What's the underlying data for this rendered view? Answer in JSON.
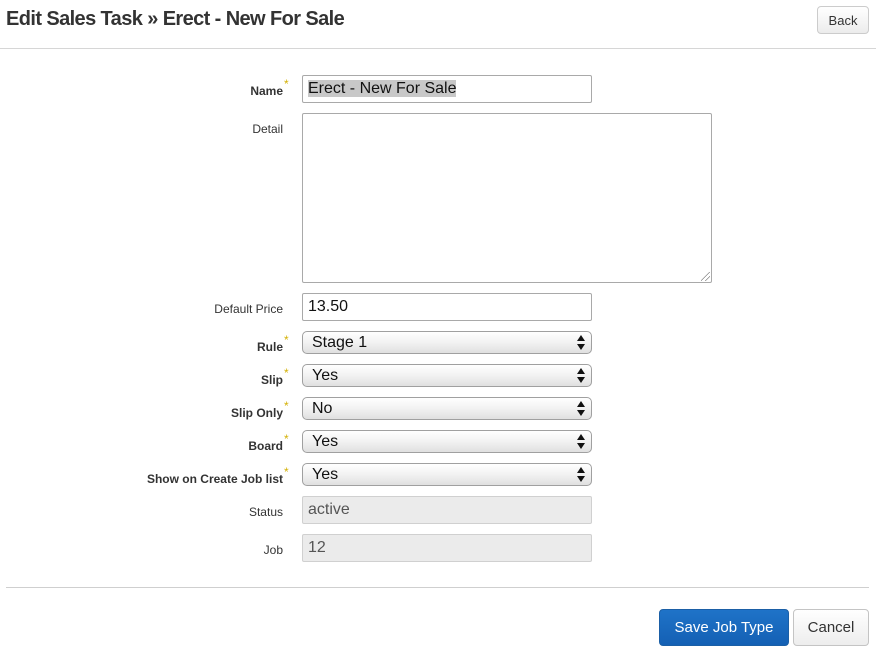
{
  "header": {
    "title": "Edit Sales Task » Erect - New For Sale",
    "back_label": "Back"
  },
  "form": {
    "required_marker": "*",
    "name": {
      "label": "Name",
      "value": "Erect - New For Sale"
    },
    "detail": {
      "label": "Detail",
      "value": ""
    },
    "default_price": {
      "label": "Default Price",
      "value": "13.50"
    },
    "rule": {
      "label": "Rule",
      "value": "Stage 1"
    },
    "slip": {
      "label": "Slip",
      "value": "Yes"
    },
    "slip_only": {
      "label": "Slip Only",
      "value": "No"
    },
    "board": {
      "label": "Board",
      "value": "Yes"
    },
    "show_on_create_job_list": {
      "label": "Show on Create Job list",
      "value": "Yes"
    },
    "status": {
      "label": "Status",
      "value": "active"
    },
    "job": {
      "label": "Job",
      "value": "12"
    }
  },
  "footer": {
    "save_label": "Save Job Type",
    "cancel_label": "Cancel"
  },
  "colors": {
    "primary_button": "#1f6ac0",
    "required_star": "#d4b106"
  },
  "icons": {
    "select_arrows": "up-down-arrows-icon",
    "textarea_resize": "resize-grip-icon"
  }
}
